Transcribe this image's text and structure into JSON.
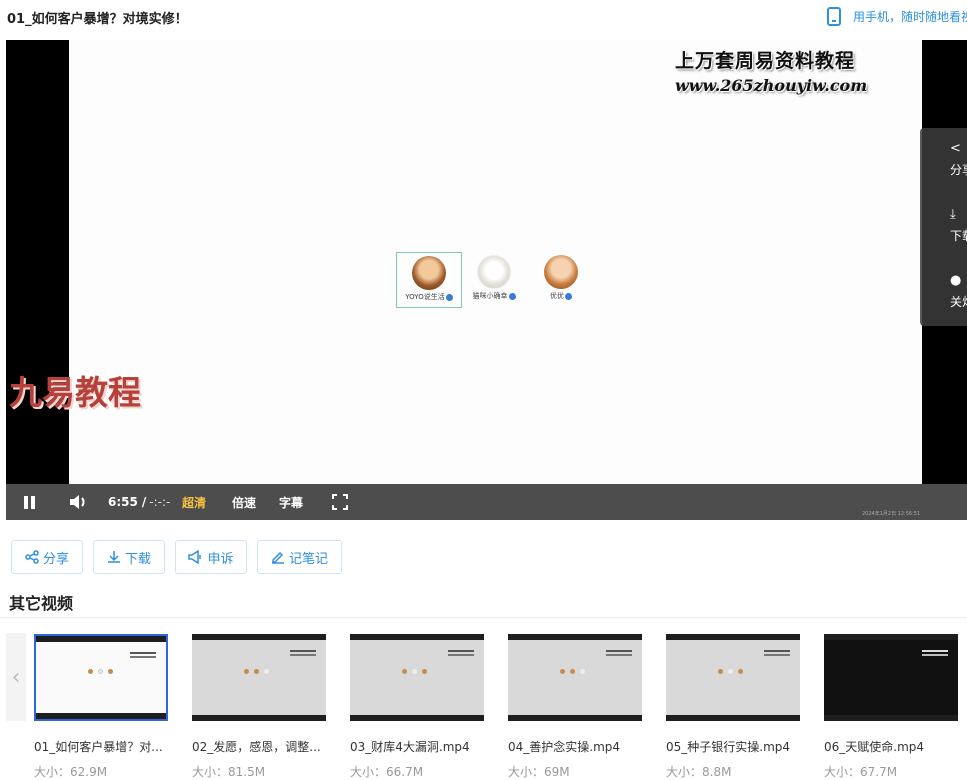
{
  "header": {
    "title": "01_如何客户暴增？对境实修！",
    "mobile_link": "用手机，随时随地看视频"
  },
  "player": {
    "watermark_title": "上万套周易资料教程",
    "watermark_url": "www.265zhouyiw.com",
    "watermark_brand": "九易教程",
    "accounts": [
      {
        "name": "YOYO说生活"
      },
      {
        "name": "猫咪小确幸"
      },
      {
        "name": "优优"
      }
    ],
    "side_panel": [
      {
        "label": "分享",
        "icon": "share-icon"
      },
      {
        "label": "下载",
        "icon": "download-icon"
      },
      {
        "label": "关灯",
        "icon": "light-icon"
      }
    ],
    "controls": {
      "current_time": "6:55",
      "separator": "/",
      "duration": "-:-:-",
      "quality": "超清",
      "speed": "倍速",
      "subtitles": "字幕"
    },
    "tiny_watermark": "2024年1月2日 12:56:51"
  },
  "actions": [
    {
      "label": "分享",
      "icon": "share-icon"
    },
    {
      "label": "下载",
      "icon": "download-icon"
    },
    {
      "label": "申诉",
      "icon": "megaphone-icon"
    },
    {
      "label": "记笔记",
      "icon": "edit-icon"
    }
  ],
  "related": {
    "title": "其它视频",
    "items": [
      {
        "title": "01_如何客户暴增？对...",
        "size": "大小：62.9M"
      },
      {
        "title": "02_发愿，感恩，调整...",
        "size": "大小：81.5M"
      },
      {
        "title": "03_财库4大漏洞.mp4",
        "size": "大小：66.7M"
      },
      {
        "title": "04_善护念实操.mp4",
        "size": "大小：69M"
      },
      {
        "title": "05_种子银行实操.mp4",
        "size": "大小：8.8M"
      },
      {
        "title": "06_天赋使命.mp4",
        "size": "大小：67.7M"
      }
    ]
  },
  "colors": {
    "accent": "#2f8fe0",
    "quality_highlight": "#f5c242",
    "active_border": "#2d67d9"
  }
}
